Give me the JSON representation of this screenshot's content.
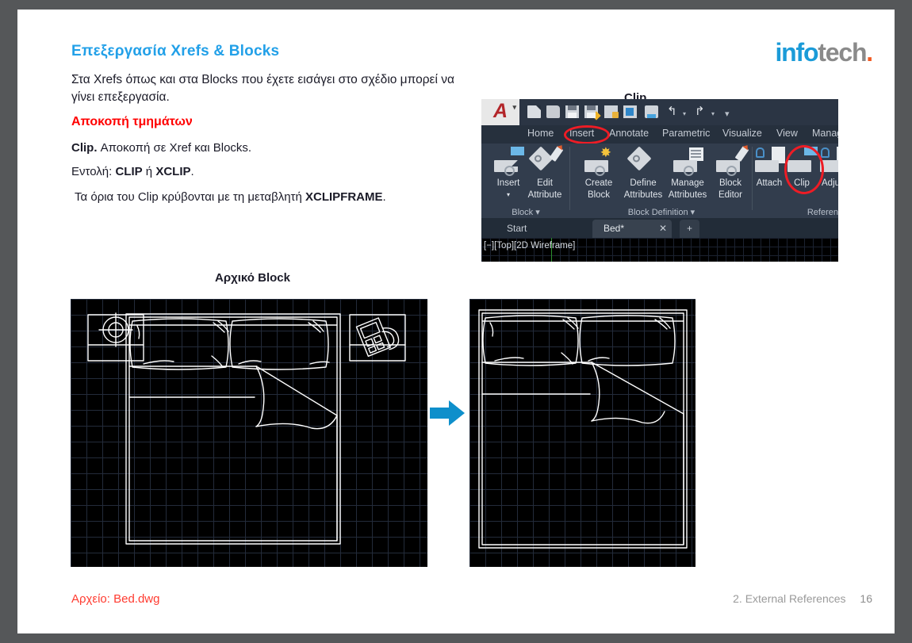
{
  "slide": {
    "title": "Επεξεργασία Xrefs & Blocks",
    "paragraph": "Στα Xrefs όπως και στα Blocks που έχετε εισάγει στο σχέδιο μπορεί να γίνει επεξεργασία.",
    "subheading_red": "Αποκοπή τμημάτων",
    "lines": [
      {
        "bold_lead": "Clip.",
        "rest": " Αποκοπή σε Xref και Blocks."
      },
      {
        "lead": "Εντολή: ",
        "bold1": "CLIP",
        "mid": " ή ",
        "bold2": "XCLIP",
        "tail": "."
      },
      {
        "lead": "Τα όρια του Clip κρύβονται με τη μεταβλητή ",
        "bold1": "XCLIPFRAME",
        "tail": "."
      }
    ],
    "clip_caption": "Clip",
    "block_caption": "Αρχικό Block",
    "file_label": "Αρχείο: Bed.dwg",
    "footer_section": "2. External References",
    "footer_page": "16"
  },
  "logo": {
    "part1": "info",
    "part2": "tech",
    "dot": "."
  },
  "autocad": {
    "app_letter": "A",
    "quick_access": [
      "new-icon",
      "open-icon",
      "save-icon",
      "save-as-icon",
      "plot-icon",
      "export-icon",
      "print-icon",
      "undo-icon",
      "redo-icon",
      "customize-icon"
    ],
    "tabs": [
      "Home",
      "Insert",
      "Annotate",
      "Parametric",
      "Visualize",
      "View",
      "Manage"
    ],
    "active_tab": "Insert",
    "panels": [
      {
        "label": "Block",
        "buttons": [
          {
            "line1": "Insert",
            "line2": ""
          },
          {
            "line1": "Edit",
            "line2": "Attribute"
          }
        ]
      },
      {
        "label": "Block Definition",
        "buttons": [
          {
            "line1": "Create",
            "line2": "Block"
          },
          {
            "line1": "Define",
            "line2": "Attributes"
          },
          {
            "line1": "Manage",
            "line2": "Attributes"
          },
          {
            "line1": "Block",
            "line2": "Editor"
          }
        ]
      },
      {
        "label": "Referen",
        "buttons": [
          {
            "line1": "Attach",
            "line2": ""
          },
          {
            "line1": "Clip",
            "line2": ""
          },
          {
            "line1": "Adjust",
            "line2": ""
          }
        ]
      }
    ],
    "highlighted_button": "Clip",
    "drawing_tabs": [
      {
        "name": "Start",
        "selected": false,
        "close": ""
      },
      {
        "name": "Bed*",
        "selected": true,
        "close": "✕"
      }
    ],
    "new_tab_glyph": "+",
    "viewport_label": "[−][Top][2D Wireframe]"
  },
  "colors": {
    "title_blue": "#22A0E8",
    "accent_red": "#FF0000",
    "arrow_blue": "#0E8FCB",
    "annotation_red": "#EE1C25",
    "logo_blue": "#1B9BD8",
    "logo_gray": "#8A8A8A",
    "logo_dot": "#F15A22"
  },
  "icons": {
    "arrow_right": "arrow-right-icon",
    "undo": "↰",
    "redo": "↱",
    "caret": "▾"
  }
}
